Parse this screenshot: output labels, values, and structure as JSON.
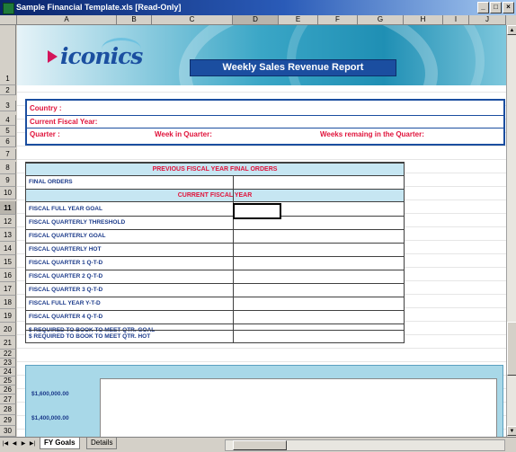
{
  "window": {
    "title": "Sample Financial Template.xls  [Read-Only]",
    "buttons": [
      "_",
      "□",
      "×"
    ]
  },
  "columns": [
    "A",
    "B",
    "C",
    "D",
    "E",
    "F",
    "G",
    "H",
    "I",
    "J"
  ],
  "rows": [
    "1",
    "2",
    "3",
    "4",
    "5",
    "6",
    "7",
    "8",
    "9",
    "10",
    "11",
    "12",
    "13",
    "14",
    "15",
    "16",
    "17",
    "18",
    "19",
    "20",
    "21",
    "22",
    "23",
    "24",
    "25",
    "26",
    "27",
    "28",
    "29",
    "30"
  ],
  "banner": {
    "logo": "iconics",
    "title": "Weekly Sales Revenue Report"
  },
  "info": {
    "country": "Country :",
    "fiscal_year": "Current Fiscal Year:",
    "quarter": "Quarter :",
    "week_in_quarter": "Week in Quarter:",
    "weeks_remaining": "Weeks remaing in the Quarter:"
  },
  "table": {
    "prev_header": "PREVIOUS FISCAL YEAR FINAL ORDERS",
    "final_orders": "FINAL ORDERS",
    "curr_header": "CURRENT  FISCAL YEAR",
    "rows": [
      "FISCAL  FULL YEAR GOAL",
      "FISCAL QUARTERLY THRESHOLD",
      "FISCAL QUARTERLY GOAL",
      "FISCAL QUARTERLY HOT",
      "FISCAL QUARTER 1  Q-T-D",
      "FISCAL QUARTER 2  Q-T-D",
      "FISCAL QUARTER 3  Q-T-D",
      "FISCAL FULL YEAR Y-T-D",
      "FISCAL QUARTER 4 Q-T-D",
      "$ REQUIRED TO BOOK TO MEET QTR. GOAL",
      "$ REQUIRED TO BOOK TO MEET QTR. HOT"
    ]
  },
  "chart": {
    "y_labels": [
      "$1,600,000.00",
      "$1,400,000.00"
    ]
  },
  "sheets": {
    "tabs": [
      "FY Goals",
      "Details"
    ],
    "active": "FY Goals"
  }
}
